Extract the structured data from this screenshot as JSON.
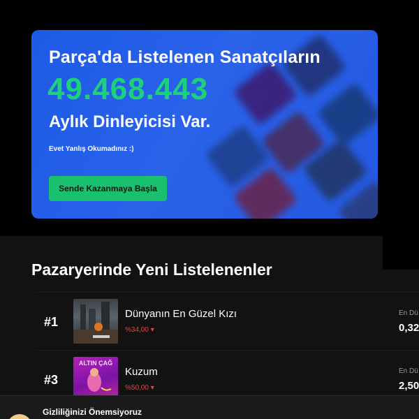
{
  "hero": {
    "title": "Parça'da Listelenen Sanatçıların",
    "number": "49.468.443",
    "subtitle": "Aylık Dinleyicisi Var.",
    "note": "Evet Yanlış Okumadınız :)",
    "cta_label": "Sende Kazanmaya Başla",
    "accent_color": "#1ed07a",
    "background_color": "#2563eb"
  },
  "new_listings": {
    "title": "Pazaryerinde Yeni Listelenenler",
    "items": [
      {
        "rank": "#1",
        "title": "Dünyanın En Güzel Kızı",
        "change": "%34,00 ▾",
        "stat_label": "En Dü",
        "stat_value": "0,32"
      },
      {
        "rank": "#3",
        "title": "Kuzum",
        "change": "%50,00 ▾",
        "stat_label": "En Dü",
        "stat_value": "2,50",
        "cover_text": "ALTIN ÇAĞ"
      }
    ]
  },
  "privacy": {
    "title": "Gizliliğinizi Önemsiyoruz"
  }
}
